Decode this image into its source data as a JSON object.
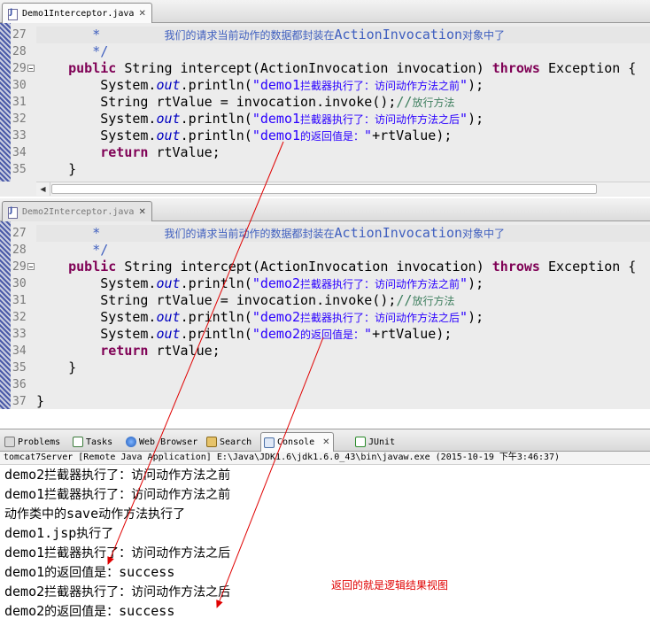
{
  "editor1": {
    "tab_label": "Demo1Interceptor.java",
    "close_glyph": "✕",
    "lines": [
      {
        "num": "27",
        "segs": [
          {
            "c": "doc",
            "t": "       *        "
          },
          {
            "c": "doc zh",
            "t": "我们的请求当前动作的数据都封装在"
          },
          {
            "c": "doc",
            "t": "ActionInvocation"
          },
          {
            "c": "doc zh",
            "t": "对象中了"
          }
        ]
      },
      {
        "num": "28",
        "segs": [
          {
            "c": "doc",
            "t": "       */"
          }
        ]
      },
      {
        "num": "29",
        "segs": [
          {
            "c": "",
            "t": "    "
          },
          {
            "c": "kw",
            "t": "public"
          },
          {
            "c": "",
            "t": " String intercept(ActionInvocation invocation) "
          },
          {
            "c": "kw",
            "t": "throws"
          },
          {
            "c": "",
            "t": " Exception {"
          }
        ]
      },
      {
        "num": "30",
        "segs": [
          {
            "c": "",
            "t": "        System."
          },
          {
            "c": "fld",
            "t": "out"
          },
          {
            "c": "",
            "t": ".println("
          },
          {
            "c": "str",
            "t": "\"demo1"
          },
          {
            "c": "str zh",
            "t": "拦截器执行了：访问动作方法之前"
          },
          {
            "c": "str",
            "t": "\""
          },
          {
            "c": "",
            "t": ");"
          }
        ]
      },
      {
        "num": "31",
        "segs": [
          {
            "c": "",
            "t": "        String rtValue = invocation.invoke();"
          },
          {
            "c": "cmt",
            "t": "//"
          },
          {
            "c": "cmt zh",
            "t": "放行方法"
          }
        ]
      },
      {
        "num": "32",
        "segs": [
          {
            "c": "",
            "t": "        System."
          },
          {
            "c": "fld",
            "t": "out"
          },
          {
            "c": "",
            "t": ".println("
          },
          {
            "c": "str",
            "t": "\"demo1"
          },
          {
            "c": "str zh",
            "t": "拦截器执行了：访问动作方法之后"
          },
          {
            "c": "str",
            "t": "\""
          },
          {
            "c": "",
            "t": ");"
          }
        ]
      },
      {
        "num": "33",
        "segs": [
          {
            "c": "",
            "t": "        System."
          },
          {
            "c": "fld",
            "t": "out"
          },
          {
            "c": "",
            "t": ".println("
          },
          {
            "c": "str",
            "t": "\"demo1"
          },
          {
            "c": "str zh",
            "t": "的返回值是："
          },
          {
            "c": "str",
            "t": "\""
          },
          {
            "c": "",
            "t": "+rtValue);"
          }
        ]
      },
      {
        "num": "34",
        "segs": [
          {
            "c": "",
            "t": "        "
          },
          {
            "c": "kw",
            "t": "return"
          },
          {
            "c": "",
            "t": " rtValue;"
          }
        ]
      },
      {
        "num": "35",
        "segs": [
          {
            "c": "",
            "t": "    }"
          }
        ]
      }
    ]
  },
  "editor2": {
    "tab_label": "Demo2Interceptor.java",
    "close_glyph": "✕",
    "lines": [
      {
        "num": "27",
        "segs": [
          {
            "c": "doc",
            "t": "       *        "
          },
          {
            "c": "doc zh",
            "t": "我们的请求当前动作的数据都封装在"
          },
          {
            "c": "doc",
            "t": "ActionInvocation"
          },
          {
            "c": "doc zh",
            "t": "对象中了"
          }
        ]
      },
      {
        "num": "28",
        "segs": [
          {
            "c": "doc",
            "t": "       */"
          }
        ]
      },
      {
        "num": "29",
        "segs": [
          {
            "c": "",
            "t": "    "
          },
          {
            "c": "kw",
            "t": "public"
          },
          {
            "c": "",
            "t": " String intercept(ActionInvocation invocation) "
          },
          {
            "c": "kw",
            "t": "throws"
          },
          {
            "c": "",
            "t": " Exception {"
          }
        ]
      },
      {
        "num": "30",
        "segs": [
          {
            "c": "",
            "t": "        System."
          },
          {
            "c": "fld",
            "t": "out"
          },
          {
            "c": "",
            "t": ".println("
          },
          {
            "c": "str",
            "t": "\"demo2"
          },
          {
            "c": "str zh",
            "t": "拦截器执行了：访问动作方法之前"
          },
          {
            "c": "str",
            "t": "\""
          },
          {
            "c": "",
            "t": ");"
          }
        ]
      },
      {
        "num": "31",
        "segs": [
          {
            "c": "",
            "t": "        String rtValue = invocation.invoke();"
          },
          {
            "c": "cmt",
            "t": "//"
          },
          {
            "c": "cmt zh",
            "t": "放行方法"
          }
        ]
      },
      {
        "num": "32",
        "segs": [
          {
            "c": "",
            "t": "        System."
          },
          {
            "c": "fld",
            "t": "out"
          },
          {
            "c": "",
            "t": ".println("
          },
          {
            "c": "str",
            "t": "\"demo2"
          },
          {
            "c": "str zh",
            "t": "拦截器执行了：访问动作方法之后"
          },
          {
            "c": "str",
            "t": "\""
          },
          {
            "c": "",
            "t": ");"
          }
        ]
      },
      {
        "num": "33",
        "segs": [
          {
            "c": "",
            "t": "        System."
          },
          {
            "c": "fld",
            "t": "out"
          },
          {
            "c": "",
            "t": ".println("
          },
          {
            "c": "str",
            "t": "\"demo2"
          },
          {
            "c": "str zh",
            "t": "的返回值是："
          },
          {
            "c": "str",
            "t": "\""
          },
          {
            "c": "",
            "t": "+rtValue);"
          }
        ]
      },
      {
        "num": "34",
        "segs": [
          {
            "c": "",
            "t": "        "
          },
          {
            "c": "kw",
            "t": "return"
          },
          {
            "c": "",
            "t": " rtValue;"
          }
        ]
      },
      {
        "num": "35",
        "segs": [
          {
            "c": "",
            "t": "    }"
          }
        ]
      },
      {
        "num": "36",
        "segs": [
          {
            "c": "",
            "t": ""
          }
        ]
      },
      {
        "num": "37",
        "segs": [
          {
            "c": "",
            "t": "}"
          }
        ]
      }
    ]
  },
  "views": {
    "problems": "Problems",
    "tasks": "Tasks",
    "web_browser": "Web Browser",
    "search": "Search",
    "console": "Console",
    "junit": "JUnit",
    "close_glyph": "✕"
  },
  "console": {
    "title": "tomcat7Server [Remote Java Application] E:\\Java\\JDK1.6\\jdk1.6.0_43\\bin\\javaw.exe (2015-10-19 下午3:46:37)",
    "lines": [
      [
        {
          "c": "",
          "t": "demo2"
        },
        {
          "c": "zh",
          "t": "拦截器执行了：访问动作方法之前"
        }
      ],
      [
        {
          "c": "",
          "t": "demo1"
        },
        {
          "c": "zh",
          "t": "拦截器执行了：访问动作方法之前"
        }
      ],
      [
        {
          "c": "zh",
          "t": "动作类中的"
        },
        {
          "c": "",
          "t": "save"
        },
        {
          "c": "zh",
          "t": "动作方法执行了"
        }
      ],
      [
        {
          "c": "",
          "t": "demo1.jsp"
        },
        {
          "c": "zh",
          "t": "执行了"
        }
      ],
      [
        {
          "c": "",
          "t": "demo1"
        },
        {
          "c": "zh",
          "t": "拦截器执行了：访问动作方法之后"
        }
      ],
      [
        {
          "c": "",
          "t": "demo1"
        },
        {
          "c": "zh",
          "t": "的返回值是："
        },
        {
          "c": "",
          "t": "success"
        }
      ],
      [
        {
          "c": "",
          "t": "demo2"
        },
        {
          "c": "zh",
          "t": "拦截器执行了：访问动作方法之后"
        }
      ],
      [
        {
          "c": "",
          "t": "demo2"
        },
        {
          "c": "zh",
          "t": "的返回值是："
        },
        {
          "c": "",
          "t": "success"
        }
      ]
    ]
  },
  "annotation": {
    "note": "返回的就是逻辑结果视图",
    "color": "#e00000"
  }
}
